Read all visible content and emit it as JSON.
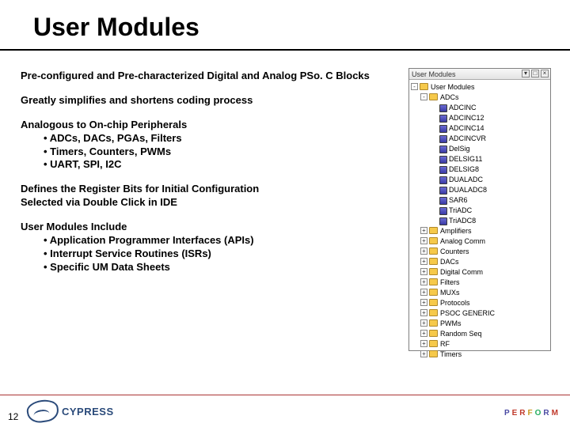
{
  "title": "User Modules",
  "content": {
    "p1": "Pre-configured and Pre-characterized Digital and Analog PSo. C Blocks",
    "p2": "Greatly simplifies and shortens coding process",
    "p3": "Analogous to On-chip Peripherals",
    "p3a": "ADCs, DACs, PGAs, Filters",
    "p3b": "Timers, Counters, PWMs",
    "p3c": "UART, SPI, I2C",
    "p4a": "Defines the Register Bits for Initial Configuration",
    "p4b": "Selected via Double Click in IDE",
    "p5": "User Modules Include",
    "p5a": "Application Programmer Interfaces (APIs)",
    "p5b": "Interrupt Service Routines (ISRs)",
    "p5c": "Specific UM Data Sheets"
  },
  "tree": {
    "header": "User Modules",
    "root": "User Modules",
    "expanded": "ADCs",
    "adc_children": [
      "ADCINC",
      "ADCINC12",
      "ADCINC14",
      "ADCINCVR",
      "DelSig",
      "DELSIG11",
      "DELSIG8",
      "DUALADC",
      "DUALADC8",
      "SAR6",
      "TriADC",
      "TriADC8"
    ],
    "collapsed": [
      "Amplifiers",
      "Analog Comm",
      "Counters",
      "DACs",
      "Digital Comm",
      "Filters",
      "MUXs",
      "Protocols",
      "PSOC GENERIC",
      "PWMs",
      "Random Seq",
      "RF",
      "Timers"
    ]
  },
  "footer": {
    "page": "12",
    "logo": "CYPRESS",
    "perform": [
      "P",
      "E",
      "R",
      "F",
      "O",
      "R",
      "M"
    ]
  }
}
